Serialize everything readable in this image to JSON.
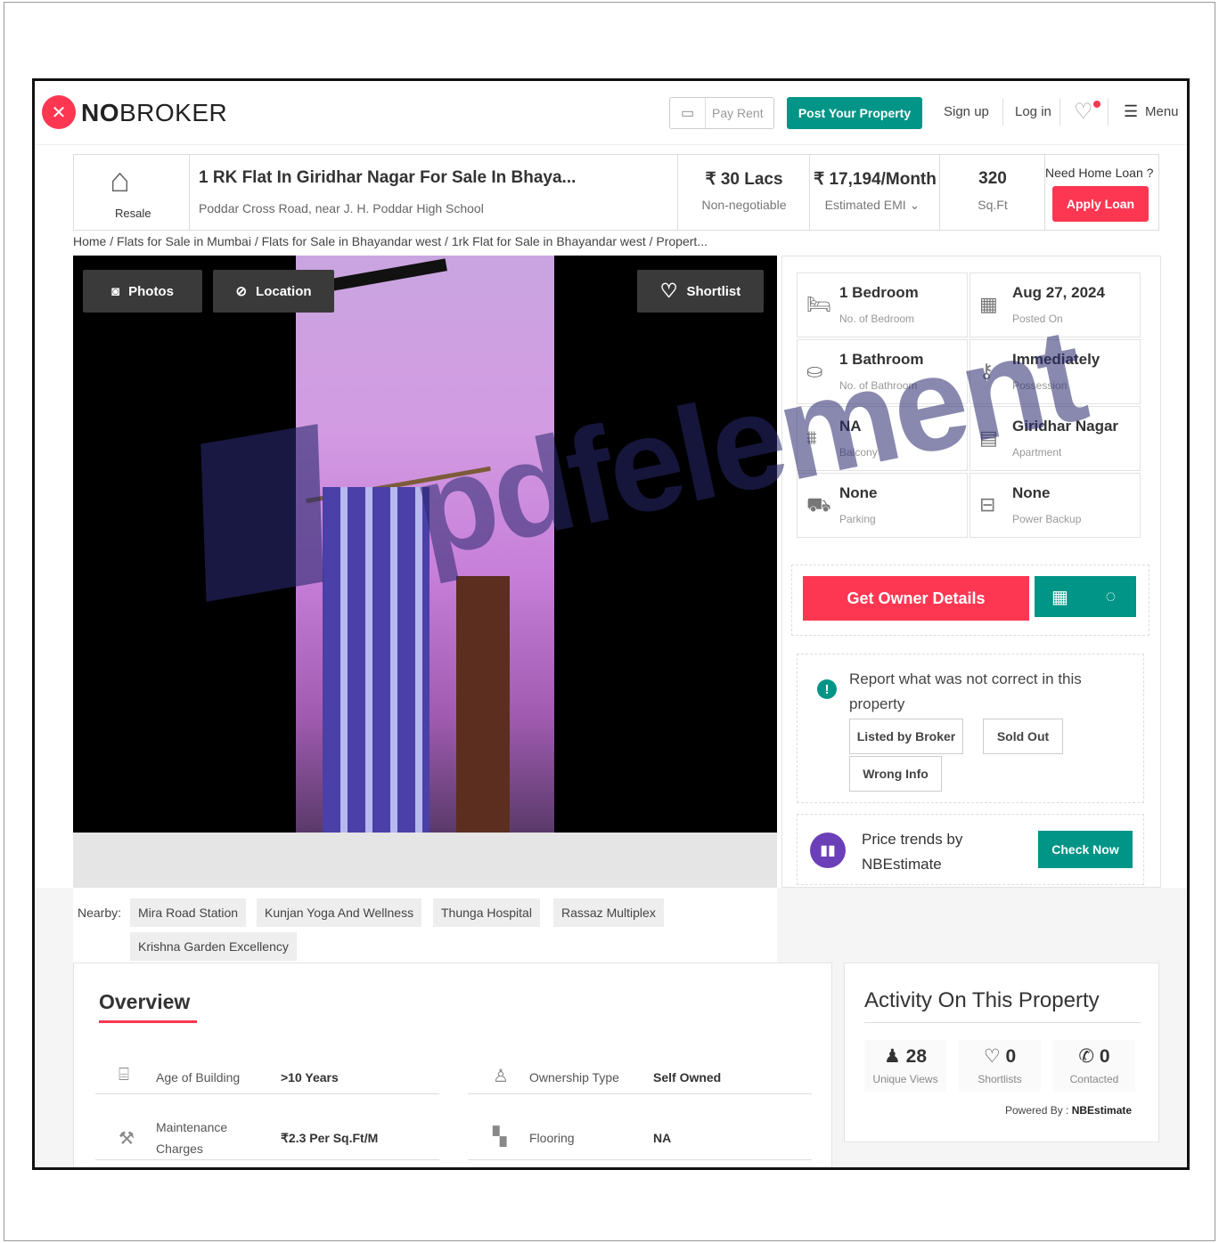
{
  "header": {
    "logo_bold": "NO",
    "logo_rest": "BROKER",
    "pay_rent": "Pay Rent",
    "post_property": "Post Your Property",
    "sign_up": "Sign up",
    "log_in": "Log in",
    "menu": "Menu"
  },
  "summary": {
    "badge_label": "Resale",
    "title": "1 RK Flat In Giridhar Nagar For Sale In Bhaya...",
    "address": "Poddar Cross Road, near J. H. Poddar High School",
    "price": "₹ 30 Lacs",
    "price_note": "Non-negotiable",
    "emi": "₹ 17,194/Month",
    "emi_note": "Estimated EMI",
    "area": "320",
    "area_unit": "Sq.Ft",
    "loan_question": "Need Home Loan ?",
    "apply_loan": "Apply Loan"
  },
  "breadcrumb": "Home / Flats for Sale in Mumbai / Flats for Sale in Bhayandar west / 1rk Flat for Sale in Bhayandar west / Propert...",
  "gallery": {
    "photos": "Photos",
    "location": "Location",
    "shortlist": "Shortlist"
  },
  "details": [
    {
      "value": "1 Bedroom",
      "label": "No. of Bedroom",
      "icon": "bed-icon"
    },
    {
      "value": "Aug 27, 2024",
      "label": "Posted On",
      "icon": "calendar-icon"
    },
    {
      "value": "1 Bathroom",
      "label": "No. of Bathroom",
      "icon": "bathtub-icon"
    },
    {
      "value": "Immediately",
      "label": "Possession",
      "icon": "key-icon"
    },
    {
      "value": "NA",
      "label": "Balcony",
      "icon": "balcony-icon"
    },
    {
      "value": "Giridhar Nagar",
      "label": "Apartment",
      "icon": "building-icon"
    },
    {
      "value": "None",
      "label": "Parking",
      "icon": "car-icon"
    },
    {
      "value": "None",
      "label": "Power Backup",
      "icon": "battery-icon"
    }
  ],
  "actions": {
    "get_owner": "Get Owner Details"
  },
  "report": {
    "text": "Report what was not correct in this property",
    "tags": [
      "Listed by Broker",
      "Sold Out",
      "Wrong Info"
    ]
  },
  "trends": {
    "text_line1": "Price trends by",
    "text_line2": "NBEstimate",
    "button": "Check Now"
  },
  "nearby": {
    "label": "Nearby:",
    "places": [
      "Mira Road Station",
      "Kunjan Yoga And Wellness",
      "Thunga Hospital",
      "Rassaz Multiplex",
      "Krishna Garden Excellency"
    ]
  },
  "overview": {
    "title": "Overview",
    "rows": [
      {
        "label": "Age of Building",
        "value": ">10 Years",
        "icon": "building-age-icon"
      },
      {
        "label": "Ownership Type",
        "value": "Self Owned",
        "icon": "owner-icon"
      },
      {
        "label_line1": "Maintenance",
        "label_line2": "Charges",
        "value": "₹2.3 Per Sq.Ft/M",
        "icon": "hammer-icon"
      },
      {
        "label": "Flooring",
        "value": "NA",
        "icon": "flooring-icon"
      }
    ]
  },
  "activity": {
    "title": "Activity On This Property",
    "stats": [
      {
        "value": "28",
        "label": "Unique Views",
        "icon": "user-icon"
      },
      {
        "value": "0",
        "label": "Shortlists",
        "icon": "heart-icon"
      },
      {
        "value": "0",
        "label": "Contacted",
        "icon": "phone-icon"
      }
    ],
    "powered_prefix": "Powered By :",
    "powered_name": "NBEstimate"
  },
  "watermark": "pdfelement",
  "colors": {
    "brand_red": "#fd3752",
    "teal": "#009587",
    "purple": "#6b3fb8"
  }
}
